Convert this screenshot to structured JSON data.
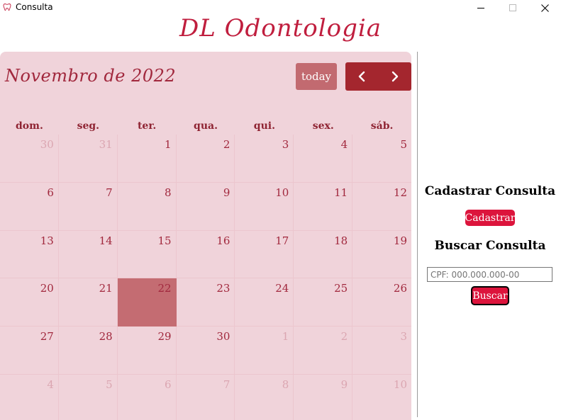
{
  "window": {
    "title": "Consulta",
    "app_icon": "tooth-icon",
    "controls": {
      "minimize": "minimize-icon",
      "maximize": "maximize-icon",
      "close": "close-icon"
    }
  },
  "header": {
    "title": "DL Odontologia"
  },
  "calendar": {
    "title": "Novembro de 2022",
    "today_label": "today",
    "prev_icon": "chevron-left-icon",
    "next_icon": "chevron-right-icon",
    "weekdays": [
      "dom.",
      "seg.",
      "ter.",
      "qua.",
      "qui.",
      "sex.",
      "sáb."
    ],
    "weeks": [
      [
        {
          "d": "30",
          "other": true
        },
        {
          "d": "31",
          "other": true
        },
        {
          "d": "1"
        },
        {
          "d": "2"
        },
        {
          "d": "3"
        },
        {
          "d": "4"
        },
        {
          "d": "5"
        }
      ],
      [
        {
          "d": "6"
        },
        {
          "d": "7"
        },
        {
          "d": "8"
        },
        {
          "d": "9"
        },
        {
          "d": "10"
        },
        {
          "d": "11"
        },
        {
          "d": "12"
        }
      ],
      [
        {
          "d": "13"
        },
        {
          "d": "14"
        },
        {
          "d": "15"
        },
        {
          "d": "16"
        },
        {
          "d": "17"
        },
        {
          "d": "18"
        },
        {
          "d": "19"
        }
      ],
      [
        {
          "d": "20"
        },
        {
          "d": "21"
        },
        {
          "d": "22",
          "today": true
        },
        {
          "d": "23"
        },
        {
          "d": "24"
        },
        {
          "d": "25"
        },
        {
          "d": "26"
        }
      ],
      [
        {
          "d": "27"
        },
        {
          "d": "28"
        },
        {
          "d": "29"
        },
        {
          "d": "30"
        },
        {
          "d": "1",
          "other": true
        },
        {
          "d": "2",
          "other": true
        },
        {
          "d": "3",
          "other": true
        }
      ],
      [
        {
          "d": "4",
          "other": true
        },
        {
          "d": "5",
          "other": true
        },
        {
          "d": "6",
          "other": true
        },
        {
          "d": "7",
          "other": true
        },
        {
          "d": "8",
          "other": true
        },
        {
          "d": "9",
          "other": true
        },
        {
          "d": "10",
          "other": true
        }
      ]
    ],
    "colors": {
      "background": "#f0d3da",
      "text": "#a1283d",
      "today_highlight": "#c46c72",
      "nav": "#a4262e"
    }
  },
  "side": {
    "cadastrar_heading": "Cadastrar Consulta",
    "cadastrar_button": "Cadastrar",
    "buscar_heading": "Buscar Consulta",
    "cpf_placeholder": "CPF: 000.000.000-00",
    "cpf_value": "",
    "buscar_button": "Buscar",
    "accent": "#dc143c"
  }
}
